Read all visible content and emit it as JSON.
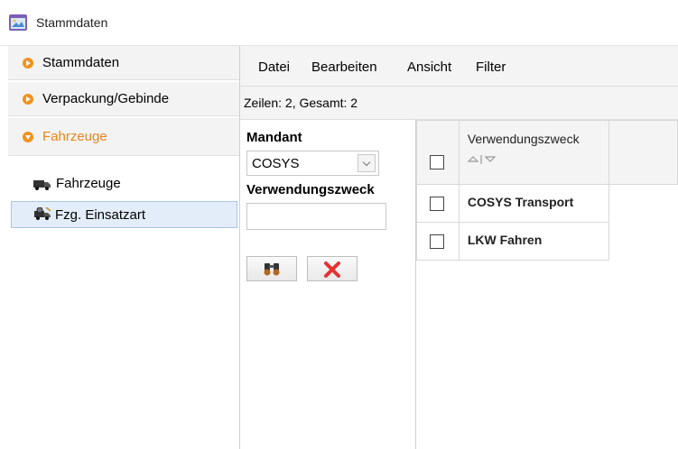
{
  "window": {
    "title": "Stammdaten"
  },
  "sidebar": {
    "sections": [
      {
        "label": "Stammdaten"
      },
      {
        "label": "Verpackung/Gebinde"
      },
      {
        "label": "Fahrzeuge"
      }
    ],
    "tree": [
      {
        "label": "Fahrzeuge",
        "icon": "truck-icon"
      },
      {
        "label": "Fzg. Einsatzart",
        "icon": "truck-settings-icon",
        "selected": true
      }
    ]
  },
  "menu": {
    "items": [
      "Datei",
      "Bearbeiten",
      "Ansicht",
      "Filter"
    ]
  },
  "status": {
    "text": "Zeilen: 2, Gesamt: 2"
  },
  "filter": {
    "mandant_label": "Mandant",
    "mandant_value": "COSYS",
    "verwendungszweck_label": "Verwendungszweck",
    "verwendungszweck_value": "",
    "search_icon": "binoculars-icon",
    "clear_icon": "red-x-icon"
  },
  "grid": {
    "column_header": "Verwendungszweck",
    "rows": [
      {
        "value": "COSYS Transport",
        "checked": false
      },
      {
        "value": "LKW Fahren",
        "checked": false
      }
    ]
  },
  "colors": {
    "accent": "#f0921e",
    "accent_text": "#e8861a",
    "selection": "#e3edf9"
  }
}
